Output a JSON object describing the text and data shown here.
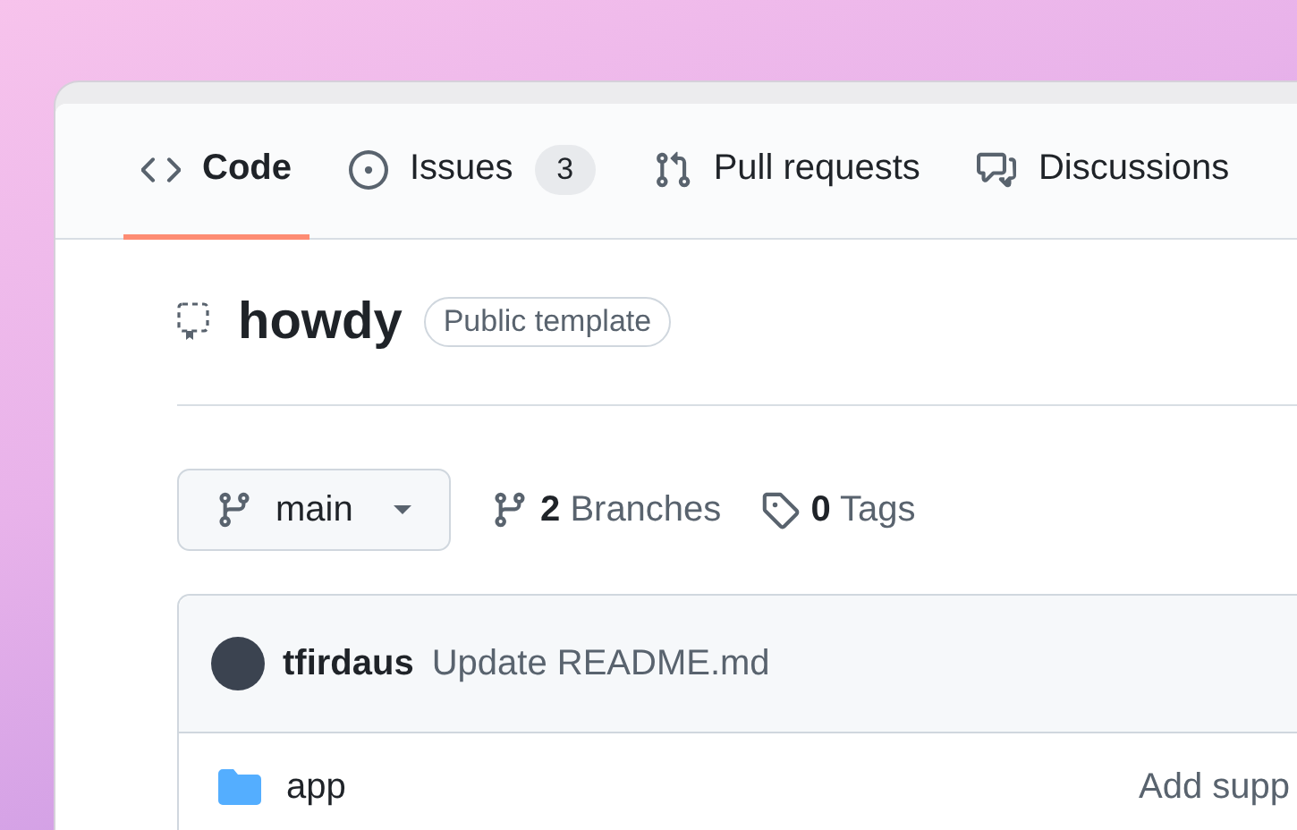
{
  "tabs": [
    {
      "kind": "code",
      "label": "Code",
      "selected": true
    },
    {
      "kind": "issues",
      "label": "Issues",
      "count": "3",
      "selected": false
    },
    {
      "kind": "pulls",
      "label": "Pull requests",
      "selected": false
    },
    {
      "kind": "discussions",
      "label": "Discussions",
      "selected": false
    }
  ],
  "repo": {
    "name": "howdy",
    "badge": "Public template"
  },
  "branch": {
    "name": "main"
  },
  "stats": [
    {
      "kind": "branches",
      "count": "2",
      "label": "Branches"
    },
    {
      "kind": "tags",
      "count": "0",
      "label": "Tags"
    }
  ],
  "commit": {
    "author": "tfirdaus",
    "message": "Update README.md"
  },
  "files": [
    {
      "kind": "folder",
      "name": "app",
      "message": "Add supp"
    }
  ]
}
